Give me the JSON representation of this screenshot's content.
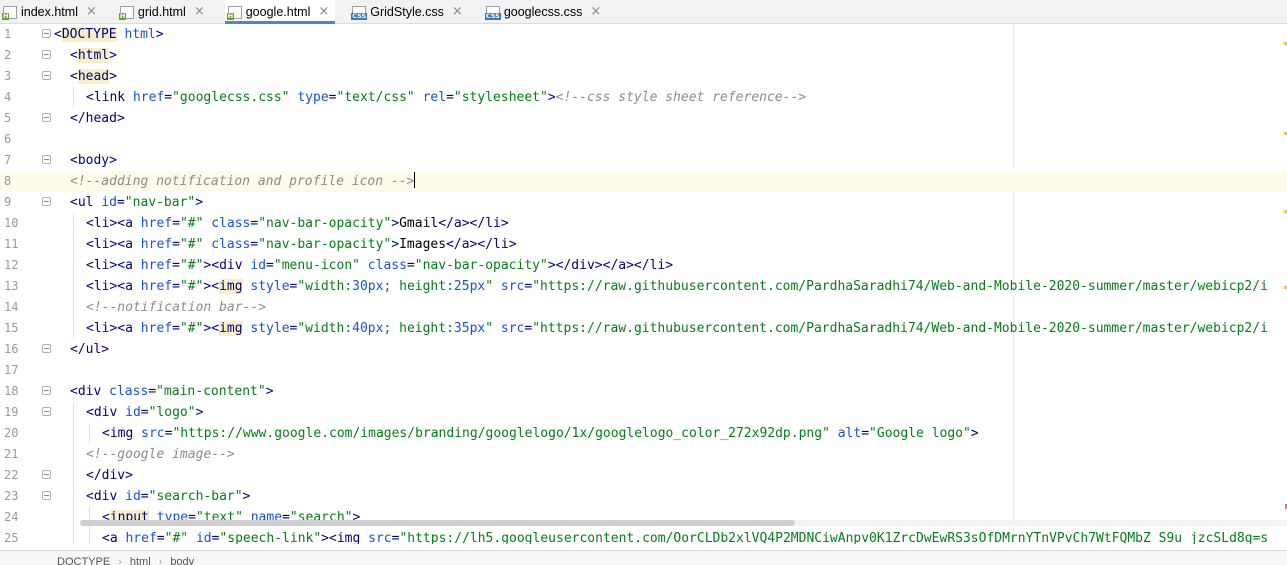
{
  "tabs": [
    {
      "label": "index.html",
      "type": "html",
      "badge": "H",
      "active": false
    },
    {
      "label": "grid.html",
      "type": "html",
      "badge": "H",
      "active": false
    },
    {
      "label": "google.html",
      "type": "html",
      "badge": "H",
      "active": true
    },
    {
      "label": "GridStyle.css",
      "type": "css",
      "badge": "CSS",
      "active": false
    },
    {
      "label": "googlecss.css",
      "type": "css",
      "badge": "CSS",
      "active": false
    }
  ],
  "close_glyph": "×",
  "current_line": 8,
  "lines": [
    {
      "n": "1",
      "fold": true,
      "indent": 0,
      "tokens": [
        [
          "t",
          "<"
        ],
        [
          "t hl",
          "DOCTYPE"
        ],
        [
          "t",
          " "
        ],
        [
          "a",
          "html"
        ],
        [
          "t",
          ">"
        ]
      ]
    },
    {
      "n": "2",
      "fold": true,
      "indent": 1,
      "tokens": [
        [
          "t",
          "<"
        ],
        [
          "t hl",
          "html"
        ],
        [
          "t",
          ">"
        ]
      ]
    },
    {
      "n": "3",
      "fold": true,
      "indent": 1,
      "tokens": [
        [
          "t",
          "<"
        ],
        [
          "t hl",
          "head"
        ],
        [
          "t",
          ">"
        ]
      ]
    },
    {
      "n": "4",
      "fold": false,
      "indent": 2,
      "tokens": [
        [
          "t",
          "<link "
        ],
        [
          "a",
          "href"
        ],
        [
          "t",
          "="
        ],
        [
          "v",
          "\"googlecss.css\""
        ],
        [
          "t",
          " "
        ],
        [
          "a",
          "type"
        ],
        [
          "t",
          "="
        ],
        [
          "v",
          "\"text/css\""
        ],
        [
          "t",
          " "
        ],
        [
          "a",
          "rel"
        ],
        [
          "t",
          "="
        ],
        [
          "v",
          "\"stylesheet\""
        ],
        [
          "t",
          ">"
        ],
        [
          "cm",
          "<!--css style sheet reference-->"
        ]
      ]
    },
    {
      "n": "5",
      "fold": true,
      "indent": 1,
      "tokens": [
        [
          "t",
          "</head>"
        ]
      ]
    },
    {
      "n": "6",
      "fold": false,
      "indent": 0,
      "tokens": []
    },
    {
      "n": "7",
      "fold": true,
      "indent": 1,
      "tokens": [
        [
          "t",
          "<body>"
        ]
      ]
    },
    {
      "n": "8",
      "fold": false,
      "indent": 1,
      "caret": true,
      "tokens": [
        [
          "cm",
          "<!--adding notification and profile icon -->"
        ]
      ]
    },
    {
      "n": "9",
      "fold": true,
      "indent": 1,
      "tokens": [
        [
          "t",
          "<ul "
        ],
        [
          "a",
          "id"
        ],
        [
          "t",
          "="
        ],
        [
          "v",
          "\"nav-bar\""
        ],
        [
          "t",
          ">"
        ]
      ]
    },
    {
      "n": "10",
      "fold": false,
      "indent": 2,
      "tokens": [
        [
          "t",
          "<li><a "
        ],
        [
          "a",
          "href"
        ],
        [
          "t",
          "="
        ],
        [
          "v",
          "\"#\""
        ],
        [
          "t",
          " "
        ],
        [
          "a",
          "class"
        ],
        [
          "t",
          "="
        ],
        [
          "v",
          "\"nav-bar-opacity\""
        ],
        [
          "t",
          ">"
        ],
        [
          "txt",
          "Gmail"
        ],
        [
          "t",
          "</a></li>"
        ]
      ]
    },
    {
      "n": "11",
      "fold": false,
      "indent": 2,
      "tokens": [
        [
          "t",
          "<li><a "
        ],
        [
          "a",
          "href"
        ],
        [
          "t",
          "="
        ],
        [
          "v",
          "\"#\""
        ],
        [
          "t",
          " "
        ],
        [
          "a",
          "class"
        ],
        [
          "t",
          "="
        ],
        [
          "v",
          "\"nav-bar-opacity\""
        ],
        [
          "t",
          ">"
        ],
        [
          "txt",
          "Images"
        ],
        [
          "t",
          "</a></li>"
        ]
      ]
    },
    {
      "n": "12",
      "fold": false,
      "indent": 2,
      "tokens": [
        [
          "t",
          "<li><a "
        ],
        [
          "a",
          "href"
        ],
        [
          "t",
          "="
        ],
        [
          "v",
          "\"#\""
        ],
        [
          "t",
          "><div "
        ],
        [
          "a",
          "id"
        ],
        [
          "t",
          "="
        ],
        [
          "v",
          "\"menu-icon\""
        ],
        [
          "t",
          " "
        ],
        [
          "a",
          "class"
        ],
        [
          "t",
          "="
        ],
        [
          "v",
          "\"nav-bar-opacity\""
        ],
        [
          "t",
          "></div></a></li>"
        ]
      ]
    },
    {
      "n": "13",
      "fold": false,
      "indent": 2,
      "tokens": [
        [
          "t",
          "<li><a "
        ],
        [
          "a",
          "href"
        ],
        [
          "t",
          "="
        ],
        [
          "v",
          "\"#\""
        ],
        [
          "t",
          "><"
        ],
        [
          "t hl",
          "img"
        ],
        [
          "t",
          " "
        ],
        [
          "a",
          "style"
        ],
        [
          "t",
          "="
        ],
        [
          "v",
          "\"width:"
        ],
        [
          "a",
          "30px"
        ],
        [
          "v",
          "; height:"
        ],
        [
          "a",
          "25px"
        ],
        [
          "v",
          "\""
        ],
        [
          "t",
          " "
        ],
        [
          "a",
          "src"
        ],
        [
          "t",
          "="
        ],
        [
          "v",
          "\"https://raw.githubusercontent.com/PardhaSaradhi74/Web-and-Mobile-2020-summer/master/webicp2/i"
        ]
      ]
    },
    {
      "n": "14",
      "fold": false,
      "indent": 2,
      "tokens": [
        [
          "cm",
          "<!--notification bar-->"
        ]
      ]
    },
    {
      "n": "15",
      "fold": false,
      "indent": 2,
      "tokens": [
        [
          "t",
          "<li><a "
        ],
        [
          "a",
          "href"
        ],
        [
          "t",
          "="
        ],
        [
          "v",
          "\"#\""
        ],
        [
          "t",
          "><"
        ],
        [
          "t hl",
          "img"
        ],
        [
          "t",
          " "
        ],
        [
          "a",
          "style"
        ],
        [
          "t",
          "="
        ],
        [
          "v",
          "\"width:"
        ],
        [
          "a",
          "40px"
        ],
        [
          "v",
          "; height:"
        ],
        [
          "a",
          "35px"
        ],
        [
          "v",
          "\""
        ],
        [
          "t",
          " "
        ],
        [
          "a",
          "src"
        ],
        [
          "t",
          "="
        ],
        [
          "v",
          "\"https://raw.githubusercontent.com/PardhaSaradhi74/Web-and-Mobile-2020-summer/master/webicp2/i"
        ]
      ]
    },
    {
      "n": "16",
      "fold": true,
      "indent": 1,
      "tokens": [
        [
          "t",
          "</ul>"
        ]
      ]
    },
    {
      "n": "17",
      "fold": false,
      "indent": 0,
      "tokens": []
    },
    {
      "n": "18",
      "fold": true,
      "indent": 1,
      "tokens": [
        [
          "t",
          "<div "
        ],
        [
          "a",
          "class"
        ],
        [
          "t",
          "="
        ],
        [
          "v",
          "\"main-content\""
        ],
        [
          "t",
          ">"
        ]
      ]
    },
    {
      "n": "19",
      "fold": true,
      "indent": 2,
      "tokens": [
        [
          "t",
          "<div "
        ],
        [
          "a",
          "id"
        ],
        [
          "t",
          "="
        ],
        [
          "v",
          "\"logo\""
        ],
        [
          "t",
          ">"
        ]
      ]
    },
    {
      "n": "20",
      "fold": false,
      "indent": 3,
      "tokens": [
        [
          "t",
          "<img "
        ],
        [
          "a",
          "src"
        ],
        [
          "t",
          "="
        ],
        [
          "v",
          "\"https://www.google.com/images/branding/googlelogo/1x/googlelogo_color_272x92dp.png\""
        ],
        [
          "t",
          " "
        ],
        [
          "a",
          "alt"
        ],
        [
          "t",
          "="
        ],
        [
          "v",
          "\"Google logo\""
        ],
        [
          "t",
          ">"
        ]
      ]
    },
    {
      "n": "21",
      "fold": false,
      "indent": 2,
      "tokens": [
        [
          "cm",
          "<!--google image-->"
        ]
      ]
    },
    {
      "n": "22",
      "fold": true,
      "indent": 2,
      "tokens": [
        [
          "t",
          "</div>"
        ]
      ]
    },
    {
      "n": "23",
      "fold": true,
      "indent": 2,
      "tokens": [
        [
          "t",
          "<div "
        ],
        [
          "a",
          "id"
        ],
        [
          "t",
          "="
        ],
        [
          "v",
          "\"search-bar\""
        ],
        [
          "t",
          ">"
        ]
      ]
    },
    {
      "n": "24",
      "fold": false,
      "indent": 3,
      "tokens": [
        [
          "t",
          "<"
        ],
        [
          "t hl",
          "input"
        ],
        [
          "t",
          " "
        ],
        [
          "a",
          "type"
        ],
        [
          "t",
          "="
        ],
        [
          "v",
          "\"text\""
        ],
        [
          "t",
          " "
        ],
        [
          "a",
          "name"
        ],
        [
          "t",
          "="
        ],
        [
          "v",
          "\"search\""
        ],
        [
          "t",
          ">"
        ]
      ]
    },
    {
      "n": "25",
      "fold": false,
      "indent": 3,
      "tokens": [
        [
          "t",
          "<a "
        ],
        [
          "a",
          "href"
        ],
        [
          "t",
          "="
        ],
        [
          "v",
          "\"#\""
        ],
        [
          "t",
          " "
        ],
        [
          "a",
          "id"
        ],
        [
          "t",
          "="
        ],
        [
          "v",
          "\"speech-link\""
        ],
        [
          "t",
          "><img "
        ],
        [
          "a",
          "src"
        ],
        [
          "t",
          "="
        ],
        [
          "v",
          "\"https://lh5.googleusercontent.com/OorCLDb2xlVQ4P2MDNCiwAnpv0K1ZrcDwEwRS3sOfDMrnYTnVPvCh7WtFQMbZ_S9u_jzcSLd8g=s"
        ]
      ]
    }
  ],
  "breadcrumbs": [
    "DOCTYPE",
    "html",
    "body"
  ],
  "breadcrumb_sep": "›",
  "colors": {
    "tag": "#000080",
    "attribute": "#1750eb",
    "value": "#067d17",
    "comment": "#8c8c8c",
    "current_line_bg": "#fcfae8",
    "active_tab_underline": "#4a88c7"
  }
}
